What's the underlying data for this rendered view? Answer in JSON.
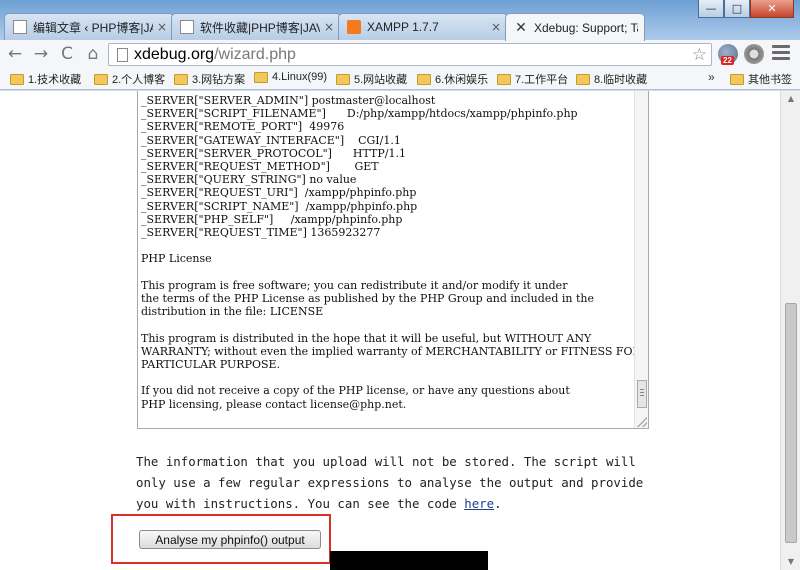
{
  "window": {
    "minimize": "—",
    "maximize": "□",
    "close": "✕"
  },
  "tabs": [
    {
      "title": "编辑文章 ‹ PHP博客|JAVA",
      "icon": "document-icon"
    },
    {
      "title": "软件收藏|PHP博客|JAVA",
      "icon": "document-icon"
    },
    {
      "title": "XAMPP 1.7.7",
      "icon": "xampp-icon"
    },
    {
      "title": "Xdebug: Support; Tailo",
      "icon": "xdebug-icon",
      "active": true
    }
  ],
  "tab_close": "×",
  "toolbar": {
    "back": "←",
    "forward": "→",
    "reload": "C",
    "home": "⌂",
    "url_host": "xdebug.org",
    "url_path": "/wizard.php",
    "bookmark_star": "☆",
    "mail_badge": "22"
  },
  "bookmarks": {
    "items": [
      "1.技术收藏",
      "2.个人博客",
      "3.网钻方案",
      "4.Linux(99)",
      "5.网站收藏",
      "6.休闲娱乐",
      "7.工作平台",
      "8.临时收藏"
    ],
    "more": "»",
    "other": "其他书签"
  },
  "textarea": {
    "lines": [
      "_SERVER[\"SERVER_ADMIN\"] postmaster@localhost",
      "_SERVER[\"SCRIPT_FILENAME\"]      D:/php/xampp/htdocs/xampp/phpinfo.php",
      "_SERVER[\"REMOTE_PORT\"]  49976",
      "_SERVER[\"GATEWAY_INTERFACE\"]    CGI/1.1",
      "_SERVER[\"SERVER_PROTOCOL\"]      HTTP/1.1",
      "_SERVER[\"REQUEST_METHOD\"]       GET",
      "_SERVER[\"QUERY_STRING\"] no value",
      "_SERVER[\"REQUEST_URI\"]  /xampp/phpinfo.php",
      "_SERVER[\"SCRIPT_NAME\"]  /xampp/phpinfo.php",
      "_SERVER[\"PHP_SELF\"]     /xampp/phpinfo.php",
      "_SERVER[\"REQUEST_TIME\"] 1365923277",
      "",
      "PHP License",
      "",
      "This program is free software; you can redistribute it and/or modify it under",
      "the terms of the PHP License as published by the PHP Group and included in the",
      "distribution in the file: LICENSE",
      "",
      "This program is distributed in the hope that it will be useful, but WITHOUT ANY",
      "WARRANTY; without even the implied warranty of MERCHANTABILITY or FITNESS FOR A",
      "PARTICULAR PURPOSE.",
      "",
      "If you did not receive a copy of the PHP license, or have any questions about",
      "PHP licensing, please contact license@php.net."
    ]
  },
  "info": {
    "text_before_link": "The information that you upload will not be stored. The script will only use a few regular expressions to analyse the output and provide you with instructions. You can see the code ",
    "link": "here",
    "text_after_link": "."
  },
  "analyse_button": "Analyse my phpinfo() output",
  "colors": {
    "highlight_border": "#d9302a",
    "link": "#1a3e8c"
  }
}
